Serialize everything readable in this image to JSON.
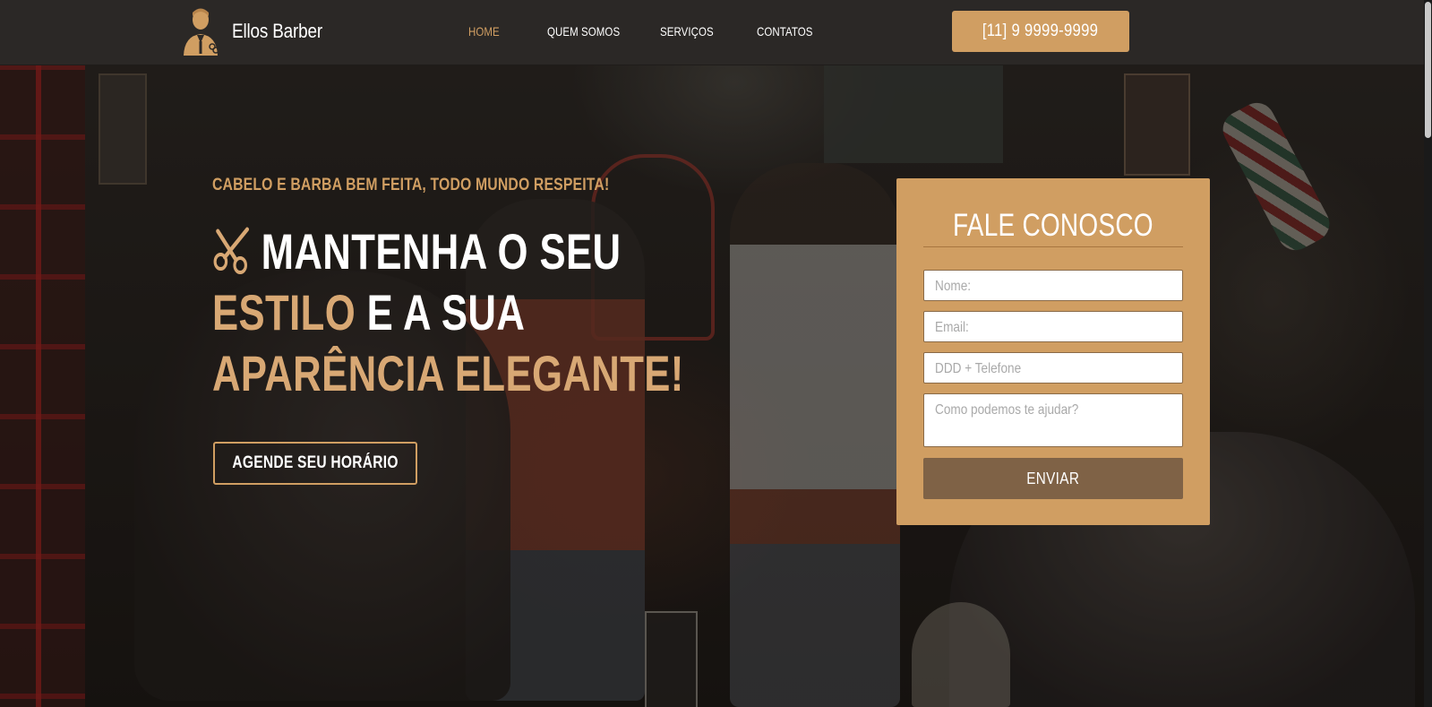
{
  "header": {
    "brand": "Ellos Barber",
    "phone": "[11] 9 9999-9999",
    "nav": [
      {
        "label": "HOME",
        "active": true
      },
      {
        "label": "QUEM SOMOS",
        "active": false
      },
      {
        "label": "SERVIÇOS",
        "active": false
      },
      {
        "label": "CONTATOS",
        "active": false
      }
    ]
  },
  "hero": {
    "tagline": "CABELO E BARBA BEM FEITA, TODO MUNDO RESPEITA!",
    "headline": {
      "line1": "MANTENHA O SEU",
      "line2_accent": "ESTILO",
      "line2_rest": " E A SUA",
      "line3": "APARÊNCIA ELEGANTE!"
    },
    "cta": "AGENDE SEU HORÁRIO"
  },
  "contact": {
    "title": "FALE CONOSCO",
    "fields": {
      "name": "Nome:",
      "email": "Email:",
      "phone": "DDD + Telefone",
      "message": "Como podemos te ajudar?"
    },
    "submit": "ENVIAR"
  },
  "colors": {
    "accent": "#d09e62",
    "header_bg": "#2b2826",
    "button_dark": "#7f6246"
  },
  "icons": {
    "logo": "barber-man-icon",
    "headline": "scissors-icon"
  }
}
